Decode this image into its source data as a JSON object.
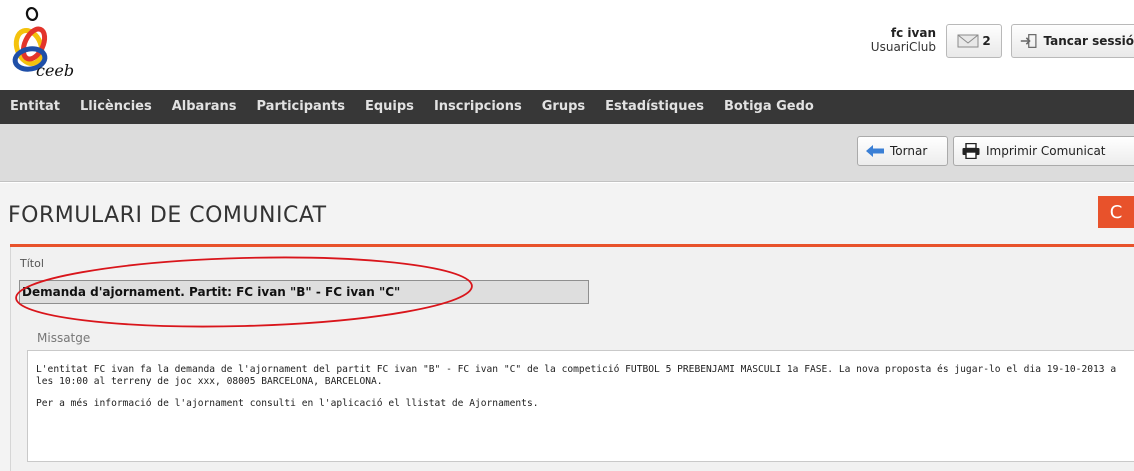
{
  "logo": {
    "alt": "ceeb logo",
    "text": "ceeb"
  },
  "user": {
    "name": "fc ivan",
    "role": "UsuariClub"
  },
  "messages": {
    "count": "2",
    "icon": "envelope-icon"
  },
  "logout": {
    "label": "Tancar sessió",
    "icon": "sign-out-icon"
  },
  "nav": {
    "items": [
      "Entitat",
      "Llicències",
      "Albarans",
      "Participants",
      "Equips",
      "Inscripcions",
      "Grups",
      "Estadístiques",
      "Botiga Gedo"
    ]
  },
  "toolbar": {
    "back_label": "Tornar",
    "back_icon": "arrow-left-icon",
    "print_label": "Imprimir Comunicat",
    "print_icon": "printer-icon"
  },
  "page": {
    "title": "FORMULARI DE COMUNICAT",
    "badge": "C"
  },
  "form": {
    "title_label": "Títol",
    "title_value": "Demanda d'ajornament. Partit: FC ivan \"B\" - FC ivan \"C\"",
    "message_label": "Missatge",
    "message_paragraphs": [
      "L'entitat FC ivan fa la demanda de l'ajornament del partit FC ivan \"B\" - FC ivan \"C\" de la competició FUTBOL 5 PREBENJAMI MASCULI 1a FASE. La nova proposta és jugar-lo el dia 19-10-2013 a les 10:00 al terreny de joc xxx, 08005 BARCELONA, BARCELONA.",
      "Per a més informació de l'ajornament consulti en l'aplicació el llistat de Ajornaments."
    ]
  },
  "colors": {
    "accent": "#e8522b",
    "nav_bg": "#373737",
    "toolbar_bg": "#dcdcdc",
    "annotation": "#d9151b"
  }
}
